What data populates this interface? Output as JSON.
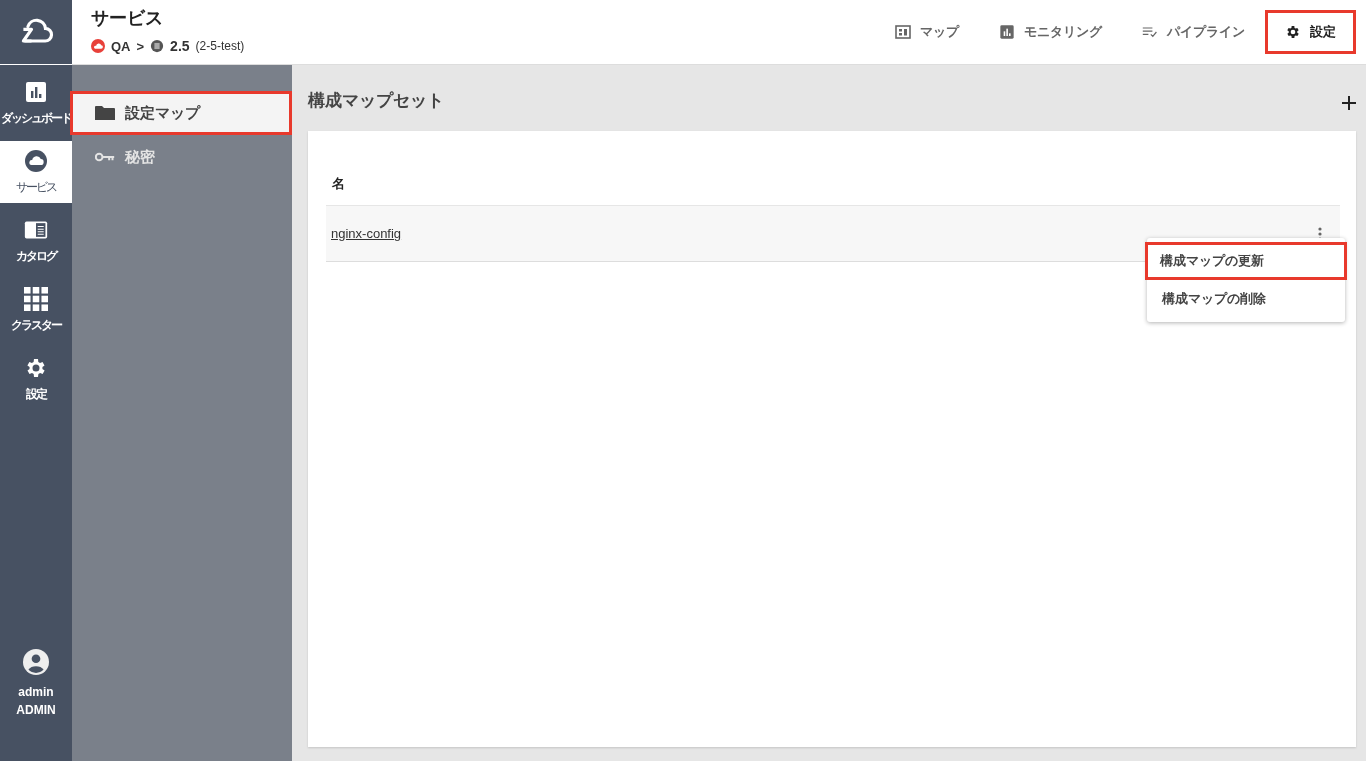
{
  "header": {
    "title": "サービス",
    "breadcrumb": {
      "project": "QA",
      "separator": ">",
      "version": "2.5",
      "version_detail": "(2-5-test)"
    }
  },
  "top_nav": [
    {
      "kind": "map",
      "label": "マップ",
      "selected": false,
      "highlighted": false
    },
    {
      "kind": "chart",
      "label": "モニタリング",
      "selected": false,
      "highlighted": false
    },
    {
      "kind": "pipeline",
      "label": "パイプライン",
      "selected": false,
      "highlighted": false
    },
    {
      "kind": "gear",
      "label": "設定",
      "selected": true,
      "highlighted": true
    }
  ],
  "rail": {
    "items": [
      {
        "kind": "chart",
        "label": "ダッシュボード",
        "selected": false
      },
      {
        "kind": "cloud",
        "label": "サービス",
        "selected": true
      },
      {
        "kind": "catalog",
        "label": "カタログ",
        "selected": false
      },
      {
        "kind": "grid",
        "label": "クラスター",
        "selected": false
      },
      {
        "kind": "gear",
        "label": "設定",
        "selected": false
      }
    ],
    "user": {
      "name": "admin",
      "role": "ADMIN"
    }
  },
  "sub_nav": [
    {
      "kind": "folder",
      "label": "設定マップ",
      "selected": true,
      "highlighted": true
    },
    {
      "kind": "key",
      "label": "秘密",
      "selected": false,
      "highlighted": false
    }
  ],
  "main": {
    "title": "構成マップセット",
    "table": {
      "columns": [
        "名"
      ],
      "rows": [
        {
          "name": "nginx-config"
        }
      ]
    },
    "row_menu": [
      {
        "label": "構成マップの更新",
        "highlighted": true
      },
      {
        "label": "構成マップの削除",
        "highlighted": false
      }
    ]
  }
}
